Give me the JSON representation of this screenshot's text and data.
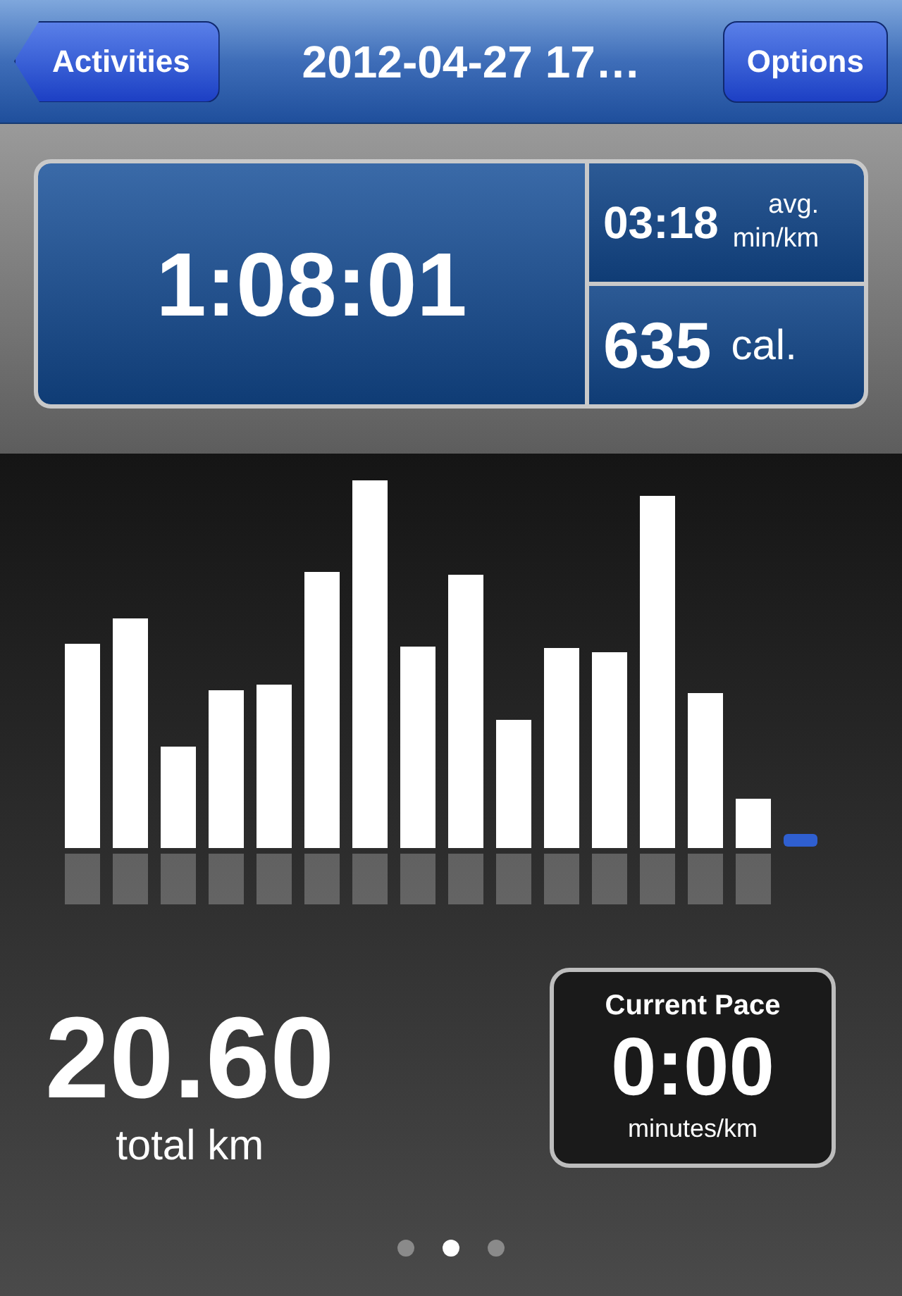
{
  "nav_bar": {
    "back_button": "Activities",
    "title": "2012-04-27 17…",
    "options_button": "Options"
  },
  "stats": {
    "duration": "1:08:01",
    "pace_value": "03:18",
    "pace_label_top": "avg.",
    "pace_label_bottom": "min/km",
    "calories_value": "635",
    "calories_unit": "cal."
  },
  "distance": {
    "value": "20.60",
    "label": "total km"
  },
  "current_pace": {
    "title": "Current Pace",
    "value": "0:00",
    "unit": "minutes/km"
  },
  "page_dots": [
    {
      "selected": false
    },
    {
      "selected": true
    },
    {
      "selected": false
    }
  ]
}
